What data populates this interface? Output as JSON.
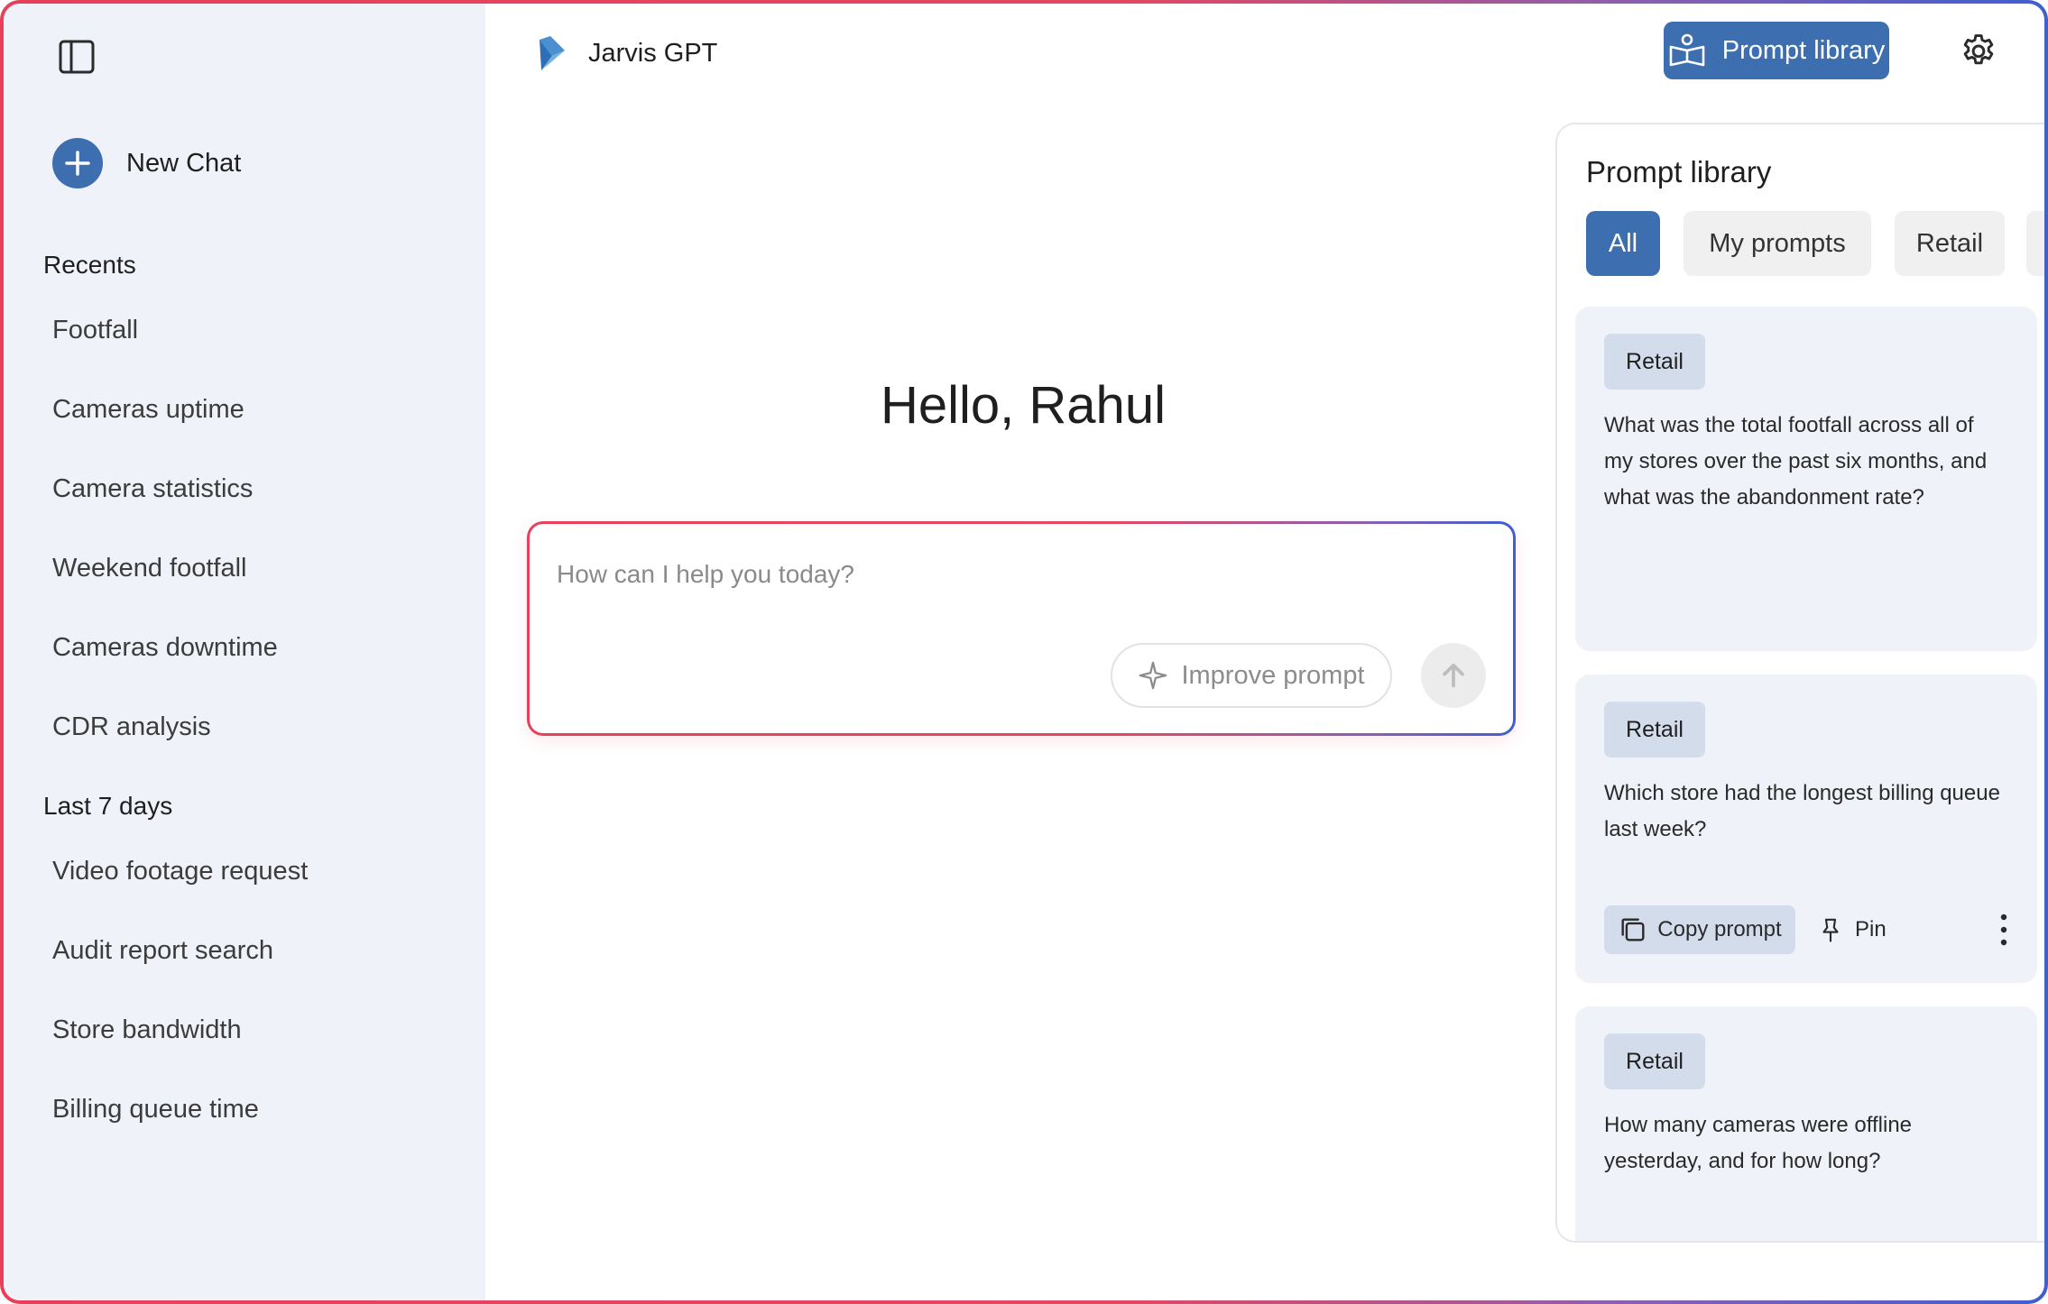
{
  "app": {
    "title": "Jarvis GPT"
  },
  "sidebar": {
    "toggle_icon": "sidebar-toggle-icon",
    "new_chat_label": "New Chat",
    "recents_title": "Recents",
    "recents": [
      "Footfall",
      "Cameras uptime",
      "Camera statistics",
      "Weekend footfall",
      "Cameras downtime",
      "CDR analysis"
    ],
    "last7_title": "Last 7 days",
    "last7": [
      "Video footage request",
      "Audit report search",
      "Store bandwidth",
      "Billing queue time"
    ]
  },
  "header": {
    "prompt_library_label": "Prompt library",
    "settings_icon": "gear-icon"
  },
  "main": {
    "greeting": "Hello, Rahul",
    "input_placeholder": "How can I help you today?",
    "improve_label": "Improve prompt"
  },
  "panel": {
    "title": "Prompt library",
    "chips": [
      "All",
      "My prompts",
      "Retail"
    ],
    "cards": [
      {
        "tag": "Retail",
        "text": "What was the total footfall across all of my stores over the past six months, and what was the abandonment rate?"
      },
      {
        "tag": "Retail",
        "text": "Which store had the longest billing queue last week?",
        "copy_label": "Copy prompt",
        "pin_label": "Pin"
      },
      {
        "tag": "Retail",
        "text": "How many cameras were offline yesterday, and for how long?"
      }
    ]
  },
  "colors": {
    "accent": "#3d6fb0",
    "sidebar_bg": "#eff2f8",
    "gradient_start": "#e8405a",
    "gradient_end": "#3f5fd0"
  }
}
